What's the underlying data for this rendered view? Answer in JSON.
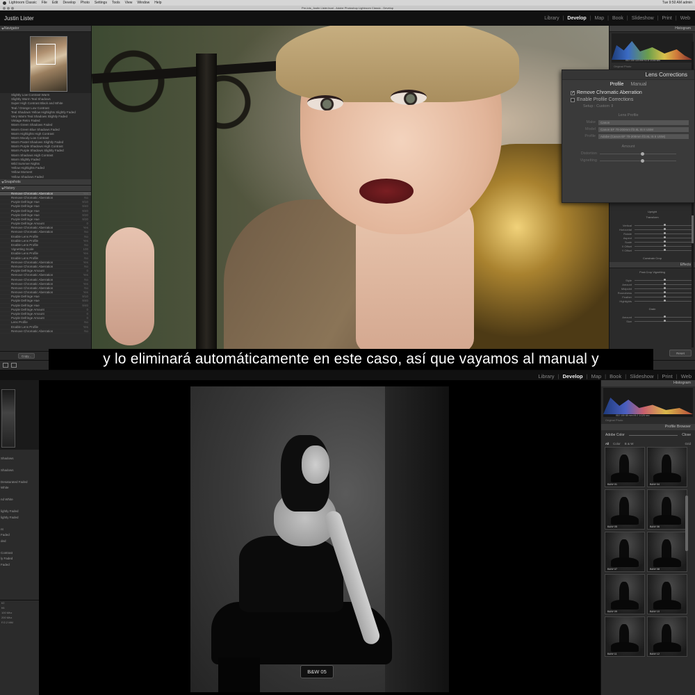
{
  "top": {
    "mac_menu": [
      "Lightroom Classic",
      "File",
      "Edit",
      "Develop",
      "Photo",
      "Settings",
      "Tools",
      "View",
      "Window",
      "Help"
    ],
    "mac_status": "Tue 9:50 AM   admin",
    "window_title": "Pre-lots_Justin Lister.lrcat - Adobe Photoshop Lightroom Classic - Develop",
    "identity_plate": "Justin Lister",
    "modules": [
      "Library",
      "Develop",
      "Map",
      "Book",
      "Slideshow",
      "Print",
      "Web"
    ],
    "active_module": "Develop",
    "navigator_label": "Navigator",
    "presets": [
      "Slightly Low Contrast Warm",
      "Slightly Warm Teal Shadows",
      "Super High Contrast Black and White",
      "Teal / Orange Low Contrast",
      "Teal Shadows Yellow Highlights Slightly Faded",
      "Very Warm Teal Shadows Slightly Faded",
      "Vintage Retro Faded",
      "Warm Green Shadows Faded",
      "Warm Green Blue Shadows Faded",
      "Warm Highlights High Contrast",
      "Warm Moody Low Contrast",
      "Warm Pastel Shadows Slightly Faded",
      "Warm Purple Shadows High Contrast",
      "Warm Purple Shadows Slightly Faded",
      "Warm Shadows High Contrast",
      "Warm Slightly Faded",
      "Wild Summer Nights",
      "Yellow Highlights Faded",
      "Yellow Moment",
      "Yellow Shadows Faded"
    ],
    "snapshots_label": "Snapshots",
    "history_label": "History",
    "history": [
      {
        "name": "Remove Chromatic Aberration",
        "val": "Yes"
      },
      {
        "name": "Remove Chromatic Aberration",
        "val": "No"
      },
      {
        "name": "Purple Defringe Hue",
        "val": "9/10"
      },
      {
        "name": "Purple Defringe Hue",
        "val": "9/40"
      },
      {
        "name": "Purple Defringe Hue",
        "val": "9/40"
      },
      {
        "name": "Purple Defringe Hue",
        "val": "9/30"
      },
      {
        "name": "Purple Defringe Hue",
        "val": "9/30"
      },
      {
        "name": "Purple Defringe Amount",
        "val": "0"
      },
      {
        "name": "Remove Chromatic Aberration",
        "val": "Yes"
      },
      {
        "name": "Remove Chromatic Aberration",
        "val": "No"
      },
      {
        "name": "Enable Lens Profile",
        "val": "No"
      },
      {
        "name": "Enable Lens Profile",
        "val": "Yes"
      },
      {
        "name": "Enable Lens Profile",
        "val": "No"
      },
      {
        "name": "Vignetting Scale",
        "val": "100"
      },
      {
        "name": "Enable Lens Profile",
        "val": "Yes"
      },
      {
        "name": "Enable Lens Profile",
        "val": "No"
      },
      {
        "name": "Remove Chromatic Aberration",
        "val": "Yes"
      },
      {
        "name": "Remove Chromatic Aberration",
        "val": "No"
      },
      {
        "name": "Purple Defringe Amount",
        "val": "0"
      },
      {
        "name": "Remove Chromatic Aberration",
        "val": "Yes"
      },
      {
        "name": "Remove Chromatic Aberration",
        "val": "No"
      },
      {
        "name": "Remove Chromatic Aberration",
        "val": "Yes"
      },
      {
        "name": "Remove Chromatic Aberration",
        "val": "No"
      },
      {
        "name": "Remove Chromatic Aberration",
        "val": "Yes"
      },
      {
        "name": "Purple Defringe Hue",
        "val": "9/10"
      },
      {
        "name": "Purple Defringe Hue",
        "val": "9/40"
      },
      {
        "name": "Purple Defringe Hue",
        "val": "9/40"
      },
      {
        "name": "Purple Defringe Amount",
        "val": "0"
      },
      {
        "name": "Purple Defringe Amount",
        "val": "0"
      },
      {
        "name": "Purple Defringe Amount",
        "val": "0"
      },
      {
        "name": "Lens Profile",
        "val": "No"
      },
      {
        "name": "Enable Lens Profile",
        "val": "Yes"
      },
      {
        "name": "Remove Chromatic Aberration",
        "val": "No"
      }
    ],
    "copy_label": "Copy...",
    "reset_label": "Reset",
    "histogram_label": "Histogram",
    "histogram_values": "ISO 100   115 mm   f/2.8   1/160 sec",
    "original_photo_label": "Original Photo",
    "upright_label": "Upright",
    "transform_label": "Transform",
    "transform_rows": [
      "Vertical",
      "Horizontal",
      "Rotate",
      "Aspect",
      "Scale",
      "X Offset",
      "Y Offset"
    ],
    "constrain_label": "Constrain Crop",
    "effects_label": "Effects",
    "post_crop_label": "Post-Crop Vignetting",
    "effects_rows": [
      "Style",
      "Amount",
      "Midpoint",
      "Roundness",
      "Feather",
      "Highlights"
    ],
    "grain_label": "Grain",
    "grain_rows": [
      "Amount",
      "Size"
    ],
    "subtitle": "y lo eliminará automáticamente en este caso, así que vayamos al manual y"
  },
  "lens": {
    "title": "Lens Corrections",
    "tabs": [
      "Profile",
      "Manual"
    ],
    "active_tab": "Profile",
    "remove_ca": "Remove Chromatic Aberration",
    "enable_profile": "Enable Profile Corrections",
    "setup_label": "Setup",
    "setup_value": "Custom",
    "lens_profile_label": "Lens Profile",
    "fields": [
      {
        "label": "Make",
        "value": "Canon"
      },
      {
        "label": "Model",
        "value": "Canon EF 70-200mm f/2.8L IS II USM"
      },
      {
        "label": "Profile",
        "value": "Adobe (Canon EF 70-200mm f/2.8L IS II USM)"
      }
    ],
    "amount_label": "Amount",
    "sliders": [
      {
        "label": "Distortion",
        "pos": 0.55
      },
      {
        "label": "Vignetting",
        "pos": 0.55
      }
    ]
  },
  "bottom": {
    "modules": [
      "Library",
      "Develop",
      "Map",
      "Book",
      "Slideshow",
      "Print",
      "Web"
    ],
    "active_module": "Develop",
    "left_items": [
      "",
      "Shadows",
      "",
      "Shadows",
      "",
      "Desaturated Faded",
      "White",
      "",
      "nd White",
      "",
      "lightly Faded",
      "lightly Faded",
      "",
      "nt",
      "Faded",
      "ded",
      "",
      "Contrast",
      "ly Faded",
      "Faded"
    ],
    "left_lower": [
      "f/2",
      "f/6",
      "100 Mhz",
      "200 Mhz",
      "F/2.2 MM"
    ],
    "histogram_label": "Histogram",
    "histogram_values": "ISO 100   85 mm   f/4.0   1/125 sec",
    "original_photo_label": "Original Photo",
    "profile_browser_label": "Profile Browser",
    "profile_name": "Adobe Color",
    "close_label": "Close",
    "tabs": [
      "All",
      "Color",
      "B & W"
    ],
    "active_tab": "All",
    "grid_label": "Grid",
    "thumbs": [
      "B&W 01",
      "B&W 04",
      "B&W 05",
      "B&W 06",
      "B&W 07",
      "B&W 08",
      "B&W 09",
      "B&W 10",
      "B&W 11",
      "B&W 12"
    ],
    "preset_label": "B&W 05"
  }
}
